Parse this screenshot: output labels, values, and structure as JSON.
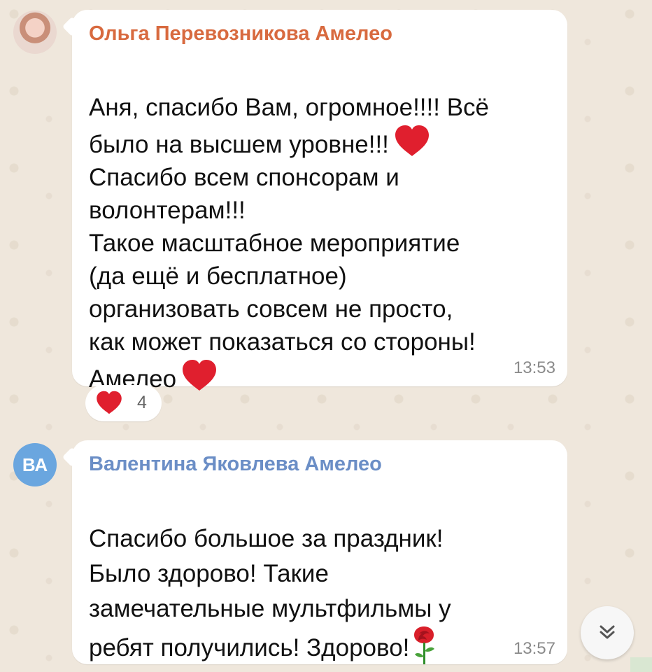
{
  "messages": [
    {
      "author": "Ольга Перевозникова Амелео",
      "text": "Аня, спасибо Вам, огромное!!!! Всё\nбыло на высшем уровне!!!",
      "text_cont": "Спасибо всем спонсорам и\nволонтерам!!!\nТакое масштабное мероприятие\n(да ещё и бесплатное)\nорганизовать совсем не просто,\nкак может показаться со стороны!\nАмелео",
      "time": "13:53",
      "reaction": {
        "icon": "red-heart-icon",
        "count": "4"
      }
    },
    {
      "avatar_initials": "ВА",
      "author": "Валентина Яковлева Амелео",
      "text": "Спасибо большое за праздник!\nБыло здорово! Такие\nзамечательные мультфильмы у\nребят получились! Здорово!",
      "time": "13:57",
      "emoji": "rose-icon"
    }
  ],
  "colors": {
    "background": "#efe7dc",
    "bubble": "#ffffff",
    "author_1": "#d86a3f",
    "author_2": "#6b8ec6",
    "avatar_2": "#6aa6df",
    "heart": "#e01f2e"
  },
  "controls": {
    "scroll_down_icon": "double-chevron-down-icon"
  }
}
